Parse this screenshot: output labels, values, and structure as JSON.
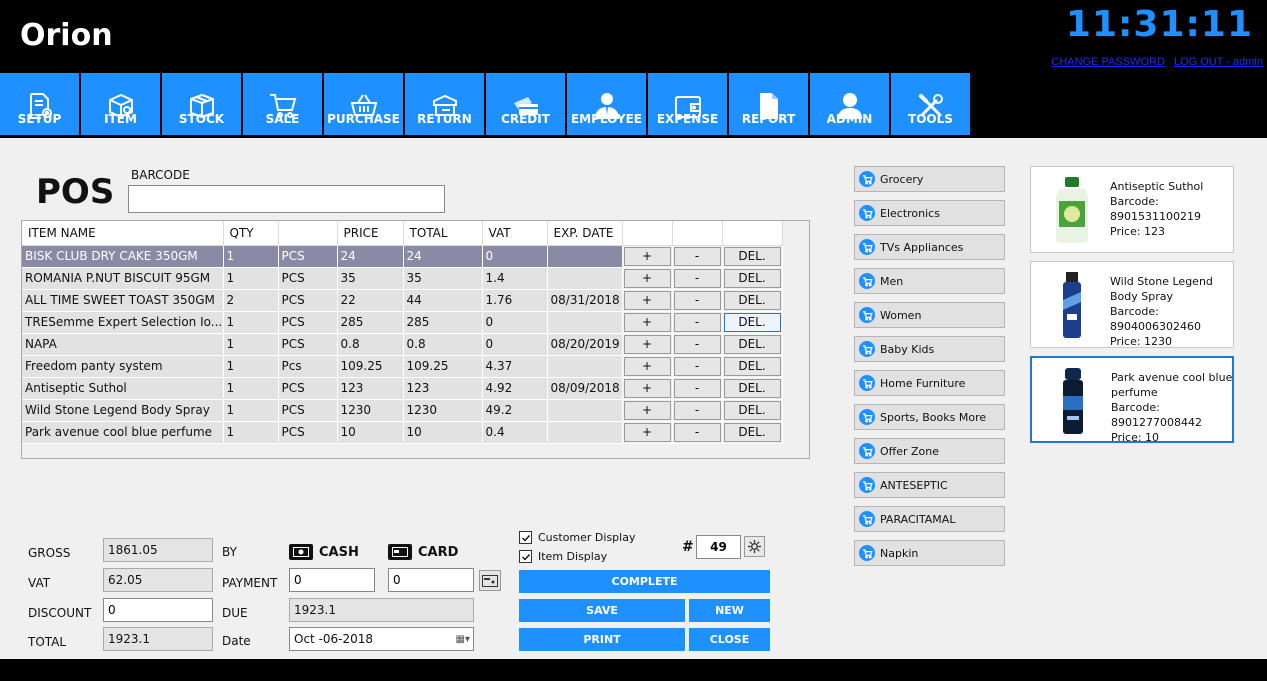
{
  "header": {
    "title": "Orion",
    "clock": "11:31:11",
    "change_password": "CHANGE PASSWORD",
    "logout": "LOG OUT - admin"
  },
  "toolbar": [
    {
      "label": "SETUP",
      "icon": "setup-gear-doc-icon"
    },
    {
      "label": "ITEM",
      "icon": "item-box-icon"
    },
    {
      "label": "STOCK",
      "icon": "stock-boxes-icon"
    },
    {
      "label": "SALE",
      "icon": "cart-icon"
    },
    {
      "label": "PURCHASE",
      "icon": "basket-icon"
    },
    {
      "label": "RETURN",
      "icon": "return-box-icon"
    },
    {
      "label": "CREDIT",
      "icon": "credit-card-icon"
    },
    {
      "label": "EMPLOYEE",
      "icon": "employee-icon"
    },
    {
      "label": "EXPENSE",
      "icon": "wallet-icon"
    },
    {
      "label": "REPORT",
      "icon": "report-doc-icon"
    },
    {
      "label": "ADMIN",
      "icon": "admin-user-icon"
    },
    {
      "label": "TOOLS",
      "icon": "tools-icon"
    }
  ],
  "pos": {
    "title": "POS",
    "barcode_label": "BARCODE",
    "barcode_value": ""
  },
  "grid": {
    "columns": [
      "ITEM NAME",
      "QTY",
      "",
      "PRICE",
      "TOTAL",
      "VAT",
      "EXP. DATE",
      "",
      "",
      ""
    ],
    "plus_label": "+",
    "minus_label": "-",
    "del_label": "DEL.",
    "rows": [
      {
        "name": "BISK CLUB DRY CAKE 350GM",
        "qty": "1",
        "unit": "PCS",
        "price": "24",
        "total": "24",
        "vat": "0",
        "exp": ""
      },
      {
        "name": "ROMANIA P.NUT BISCUIT 95GM",
        "qty": "1",
        "unit": "PCS",
        "price": "35",
        "total": "35",
        "vat": "1.4",
        "exp": ""
      },
      {
        "name": "ALL TIME SWEET TOAST 350GM",
        "qty": "2",
        "unit": "PCS",
        "price": "22",
        "total": "44",
        "vat": "1.76",
        "exp": "08/31/2018"
      },
      {
        "name": "TRESemme Expert Selection Io...",
        "qty": "1",
        "unit": "PCS",
        "price": "285",
        "total": "285",
        "vat": "0",
        "exp": ""
      },
      {
        "name": "NAPA",
        "qty": "1",
        "unit": "PCS",
        "price": "0.8",
        "total": "0.8",
        "vat": "0",
        "exp": "08/20/2019"
      },
      {
        "name": "Freedom panty system",
        "qty": "1",
        "unit": "Pcs",
        "price": "109.25",
        "total": "109.25",
        "vat": "4.37",
        "exp": ""
      },
      {
        "name": "Antiseptic Suthol",
        "qty": "1",
        "unit": "PCS",
        "price": "123",
        "total": "123",
        "vat": "4.92",
        "exp": "08/09/2018"
      },
      {
        "name": "Wild Stone Legend Body Spray",
        "qty": "1",
        "unit": "PCS",
        "price": "1230",
        "total": "1230",
        "vat": "49.2",
        "exp": ""
      },
      {
        "name": "Park avenue cool blue perfume",
        "qty": "1",
        "unit": "PCS",
        "price": "10",
        "total": "10",
        "vat": "0.4",
        "exp": ""
      }
    ]
  },
  "categories": [
    "Grocery",
    "Electronics",
    "TVs  Appliances",
    "Men",
    "Women",
    "Baby  Kids",
    "Home  Furniture",
    "Sports, Books  More",
    "Offer Zone",
    "ANTESEPTIC",
    "PARACITAMAL",
    "Napkin"
  ],
  "products": [
    {
      "name": "Antiseptic Suthol",
      "barcode_label": "Barcode:",
      "barcode": "8901531100219",
      "price": "Price: 123"
    },
    {
      "name": "Wild Stone Legend Body Spray",
      "barcode_label": "Barcode:",
      "barcode": "8904006302460",
      "price": "Price: 1230"
    },
    {
      "name": "Park avenue cool blue perfume",
      "barcode_label": "Barcode:",
      "barcode": "8901277008442",
      "price": "Price: 10"
    }
  ],
  "totals": {
    "gross_label": "GROSS",
    "gross": "1861.05",
    "vat_label": "VAT",
    "vat": "62.05",
    "discount_label": "DISCOUNT",
    "discount": "0",
    "total_label": "TOTAL",
    "total": "1923.1",
    "by_label": "BY",
    "payment_label": "PAYMENT",
    "due_label": "DUE",
    "due": "1923.1",
    "date_label": "Date",
    "date": "Oct -06-2018",
    "cash_label": "CASH",
    "cash_value": "0",
    "card_label": "CARD",
    "card_value": "0"
  },
  "options": {
    "customer_display": "Customer Display",
    "item_display": "Item Display",
    "hash": "#",
    "counter": "49"
  },
  "actions": {
    "complete": "COMPLETE",
    "save": "SAVE",
    "new": "NEW",
    "print": "PRINT",
    "close": "CLOSE"
  },
  "colors": {
    "accent": "#1e90ff",
    "selected_row": "#8a8aa6",
    "clock": "#1e90ff"
  }
}
